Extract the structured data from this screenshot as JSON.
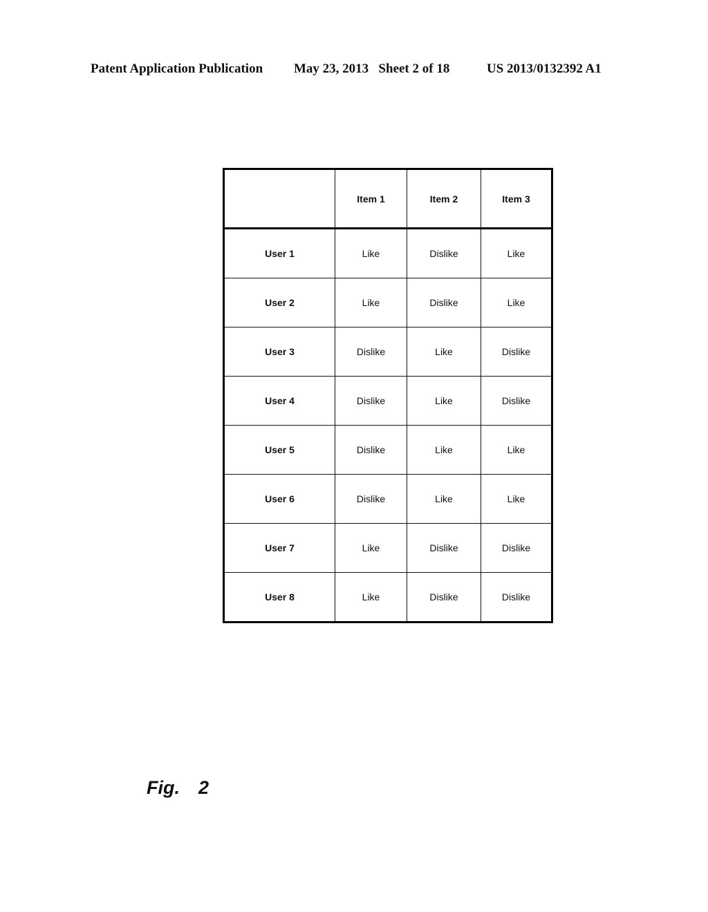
{
  "header": {
    "publication": "Patent Application Publication",
    "date_sheet": "May 23, 2013   Sheet 2 of 18",
    "patent_number": "US 2013/0132392 A1"
  },
  "table": {
    "corner": "",
    "columns": [
      "Item 1",
      "Item 2",
      "Item 3"
    ],
    "rows": [
      {
        "label": "User 1",
        "values": [
          "Like",
          "Dislike",
          "Like"
        ]
      },
      {
        "label": "User 2",
        "values": [
          "Like",
          "Dislike",
          "Like"
        ]
      },
      {
        "label": "User 3",
        "values": [
          "Dislike",
          "Like",
          "Dislike"
        ]
      },
      {
        "label": "User 4",
        "values": [
          "Dislike",
          "Like",
          "Dislike"
        ]
      },
      {
        "label": "User 5",
        "values": [
          "Dislike",
          "Like",
          "Like"
        ]
      },
      {
        "label": "User 6",
        "values": [
          "Dislike",
          "Like",
          "Like"
        ]
      },
      {
        "label": "User 7",
        "values": [
          "Like",
          "Dislike",
          "Dislike"
        ]
      },
      {
        "label": "User 8",
        "values": [
          "Like",
          "Dislike",
          "Dislike"
        ]
      }
    ]
  },
  "figure_label": "Fig.  2"
}
